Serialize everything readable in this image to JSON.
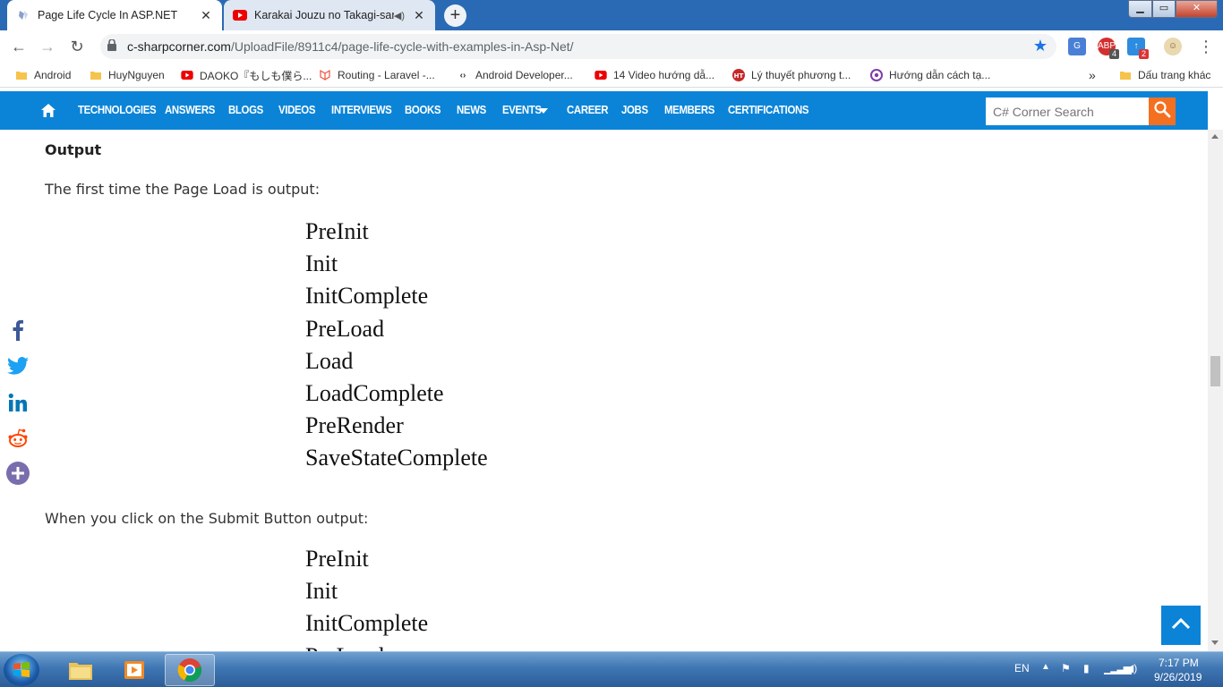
{
  "browser": {
    "tabs": [
      {
        "title": "Page Life Cycle In ASP.NET",
        "active": true
      },
      {
        "title": "Karakai Jouzu no Takagi-san",
        "active": false
      }
    ],
    "url_host": "c-sharpcorner.com",
    "url_path": "/UploadFile/8911c4/page-life-cycle-with-examples-in-Asp-Net/",
    "extensions": [
      {
        "name": "translate-icon",
        "badge": ""
      },
      {
        "name": "adblock-icon",
        "badge": "4"
      },
      {
        "name": "extension-blue-icon",
        "badge": "2"
      },
      {
        "name": "profile-icon",
        "badge": ""
      }
    ]
  },
  "bookmarks": [
    {
      "label": "Android",
      "icon": "folder-icon"
    },
    {
      "label": "HuyNguyen",
      "icon": "folder-icon"
    },
    {
      "label": "DAOKO『もしも僕ら...",
      "icon": "youtube-icon"
    },
    {
      "label": "Routing - Laravel -...",
      "icon": "laravel-icon"
    },
    {
      "label": "Android Developer...",
      "icon": "code-icon"
    },
    {
      "label": "14 Video hướng dẫ...",
      "icon": "youtube-icon"
    },
    {
      "label": "Lý thuyết phương t...",
      "icon": "ht-icon"
    },
    {
      "label": "Hướng dẫn cách tạ...",
      "icon": "at-icon"
    }
  ],
  "bookmarks_overflow": "»",
  "bookmarks_other": "Dấu trang khác",
  "site_nav": {
    "items": [
      "TECHNOLOGIES",
      "ANSWERS",
      "BLOGS",
      "VIDEOS",
      "INTERVIEWS",
      "BOOKS",
      "NEWS",
      "EVENTS",
      "CAREER",
      "JOBS",
      "MEMBERS",
      "CERTIFICATIONS"
    ],
    "search_placeholder": "C# Corner Search"
  },
  "article": {
    "heading": "Output",
    "first_intro": "The first time the Page Load is output:",
    "first_list": [
      "PreInit",
      "Init",
      "InitComplete",
      "PreLoad",
      "Load",
      "LoadComplete",
      "PreRender",
      "SaveStateComplete"
    ],
    "second_intro": "When you click on the Submit Button output:",
    "second_list": [
      "PreInit",
      "Init",
      "InitComplete",
      "PreLoad"
    ]
  },
  "share_icons": [
    "facebook-icon",
    "twitter-icon",
    "linkedin-icon",
    "reddit-icon",
    "more-share-icon"
  ],
  "taskbar": {
    "language": "EN",
    "time": "7:17 PM",
    "date": "9/26/2019"
  },
  "colors": {
    "nav_blue": "#0b84d8",
    "search_orange": "#f47021",
    "tabstrip_blue": "#2a6ab4"
  }
}
